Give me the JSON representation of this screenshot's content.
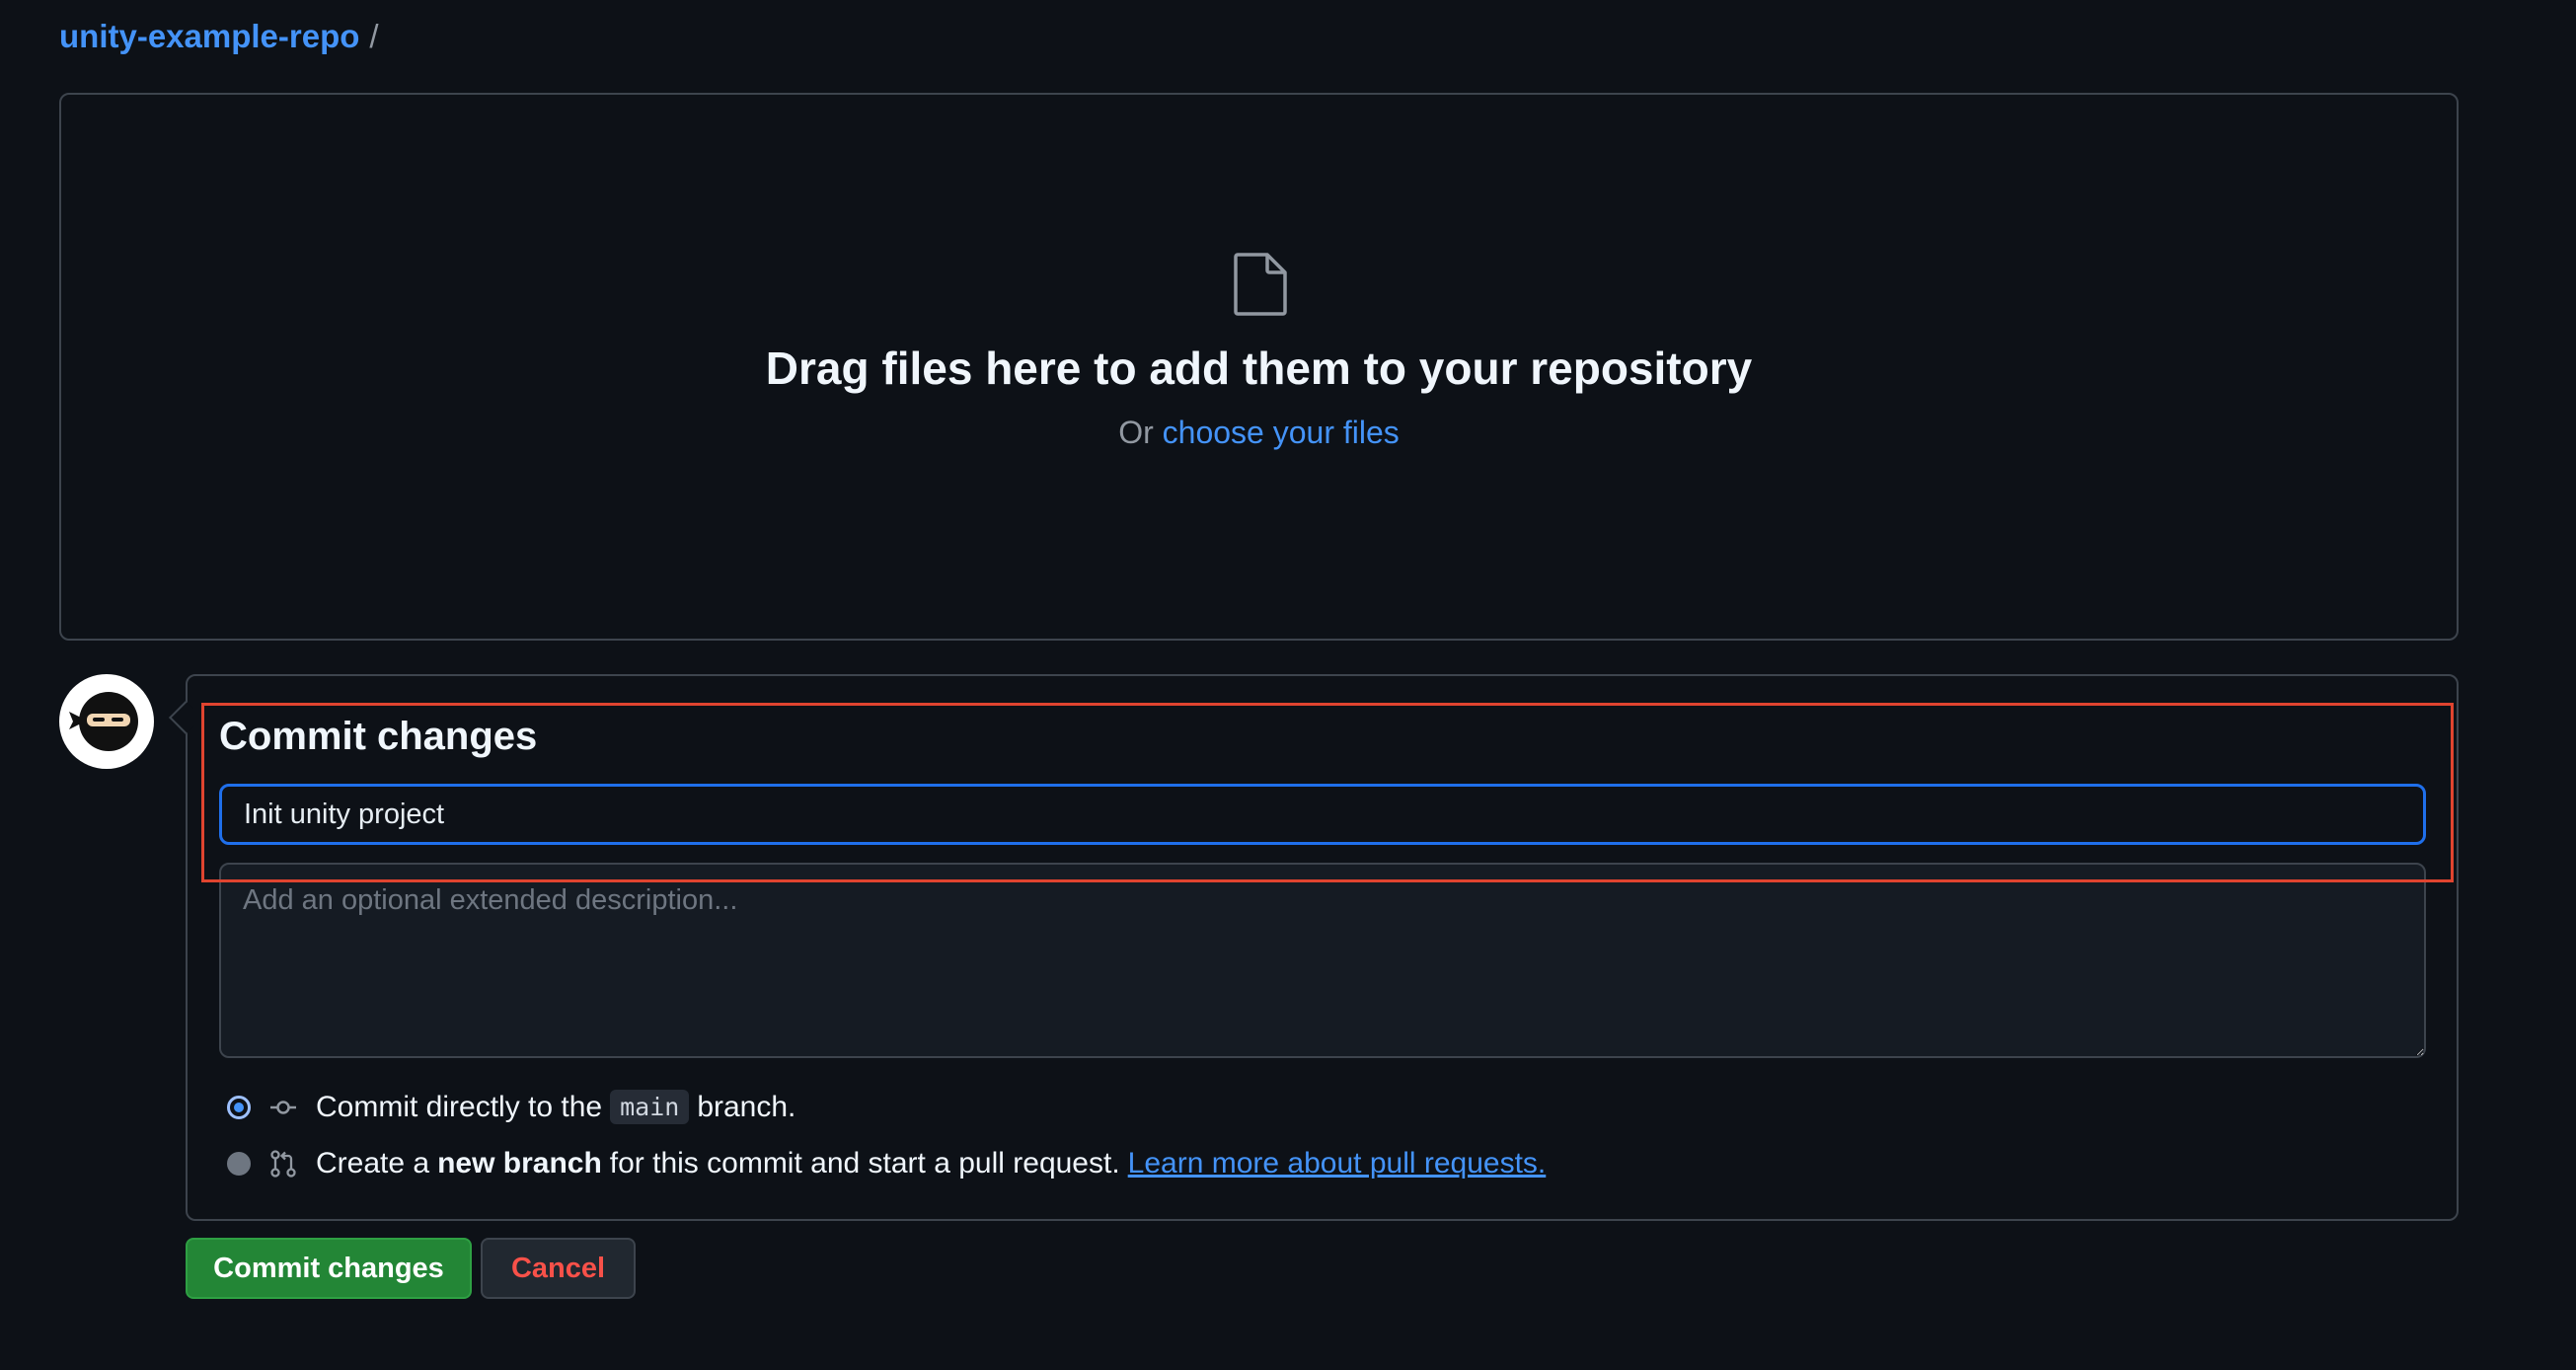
{
  "breadcrumb": {
    "repo": "unity-example-repo",
    "separator": "/"
  },
  "dropzone": {
    "icon": "file-icon",
    "title": "Drag files here to add them to your repository",
    "prefix": "Or",
    "choose_link": "choose your files"
  },
  "commit": {
    "heading": "Commit changes",
    "summary_value": "Init unity project",
    "description_placeholder": "Add an optional extended description...",
    "options": {
      "direct": {
        "checked": true,
        "icon": "git-commit-icon",
        "text_before": "Commit directly to the",
        "branch": "main",
        "text_after": "branch."
      },
      "new_branch": {
        "checked": false,
        "icon": "git-pull-request-icon",
        "text_before": "Create a",
        "bold": "new branch",
        "text_after": "for this commit and start a pull request.",
        "link": "Learn more about pull requests."
      }
    }
  },
  "buttons": {
    "commit": "Commit changes",
    "cancel": "Cancel"
  },
  "colors": {
    "background": "#0d1117",
    "link": "#4493f8",
    "primary_button": "#238636",
    "cancel_text": "#f85149",
    "highlight": "#e0442f",
    "focus_border": "#1f6feb"
  }
}
